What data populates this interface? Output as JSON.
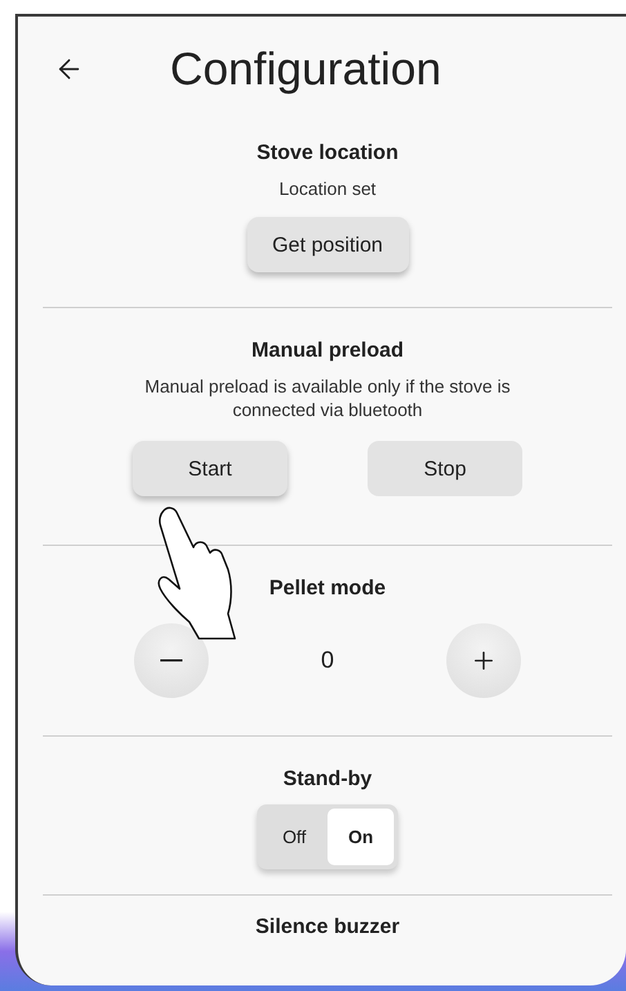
{
  "header": {
    "title": "Configuration"
  },
  "sections": [
    {
      "kind": "action",
      "title": "Stove location",
      "description": "Location set",
      "buttons": [
        {
          "label": "Get position",
          "elevated": true
        }
      ]
    },
    {
      "kind": "action",
      "title": "Manual preload",
      "description": "Manual preload is available only if the stove is connected via bluetooth",
      "buttons": [
        {
          "label": "Start",
          "elevated": true
        },
        {
          "label": "Stop",
          "elevated": false
        }
      ]
    },
    {
      "kind": "stepper",
      "title": "Pellet mode",
      "value": "0"
    },
    {
      "kind": "toggle",
      "title": "Stand-by",
      "options": [
        {
          "label": "Off",
          "selected": false
        },
        {
          "label": "On",
          "selected": true
        }
      ]
    },
    {
      "kind": "heading",
      "title": "Silence buzzer"
    }
  ]
}
